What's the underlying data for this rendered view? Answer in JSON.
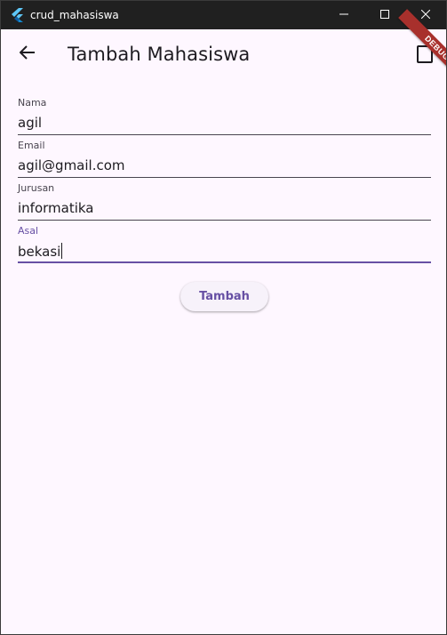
{
  "window": {
    "title": "crud_mahasiswa",
    "controls": {
      "minimize": "minimize-icon",
      "maximize": "maximize-icon",
      "close": "close-icon"
    }
  },
  "appbar": {
    "title": "Tambah Mahasiswa",
    "back_icon": "arrow-back-icon",
    "debug_banner": "DEBUG"
  },
  "form": {
    "fields": [
      {
        "label": "Nama",
        "value": "agil"
      },
      {
        "label": "Email",
        "value": "agil@gmail.com"
      },
      {
        "label": "Jurusan",
        "value": "informatika"
      },
      {
        "label": "Asal",
        "value": "bekasi"
      }
    ],
    "submit_label": "Tambah"
  },
  "colors": {
    "background": "#fef7ff",
    "primary": "#6750a4",
    "titlebar": "#202020",
    "debug_banner": "#a8302c"
  }
}
